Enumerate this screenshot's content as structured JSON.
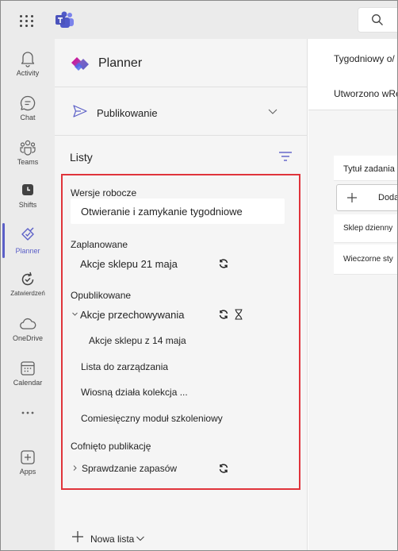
{
  "rail": {
    "items": [
      {
        "label": "Activity",
        "icon": "bell-icon"
      },
      {
        "label": "Chat",
        "icon": "chat-icon"
      },
      {
        "label": "Teams",
        "icon": "teams-icon"
      },
      {
        "label": "Shifts",
        "icon": "shifts-icon"
      },
      {
        "label": "Planner",
        "icon": "planner-icon"
      },
      {
        "label": "Zatwierdzeń",
        "icon": "approvals-icon"
      },
      {
        "label": "OneDrive",
        "icon": "cloud-icon"
      },
      {
        "label": "Calendar",
        "icon": "calendar-icon"
      },
      {
        "label": "Apps",
        "icon": "apps-icon"
      }
    ]
  },
  "panel": {
    "title": "Planner",
    "publish_label": "Publikowanie",
    "lists_heading": "Listy",
    "new_list_label": "Nowa lista"
  },
  "sections": {
    "drafts": {
      "label": "Wersje robocze",
      "items": [
        "Otwieranie i zamykanie tygodniowe"
      ]
    },
    "scheduled": {
      "label": "Zaplanowane",
      "items": [
        "Akcje sklepu 21 maja"
      ]
    },
    "published": {
      "label": "Opublikowane",
      "items": [
        "Akcje przechowywania",
        "Akcje sklepu z 14 maja",
        "Lista do zarządzania",
        "Wiosną działa kolekcja ...",
        "Comiesięczny moduł szkoleniowy"
      ]
    },
    "unpublished": {
      "label": "Cofnięto publikację",
      "items": [
        "Sprawdzanie zapasów"
      ]
    }
  },
  "main": {
    "row1": "Tygodniowy o/",
    "row2": "Utworzono wRe",
    "table_header": "Tytuł zadania",
    "add_label": "Dodaj",
    "rows": [
      "Sklep dzienny",
      "Wieczorne sty"
    ]
  },
  "colors": {
    "accent": "#5b5fc7",
    "highlight": "#e0343b"
  }
}
